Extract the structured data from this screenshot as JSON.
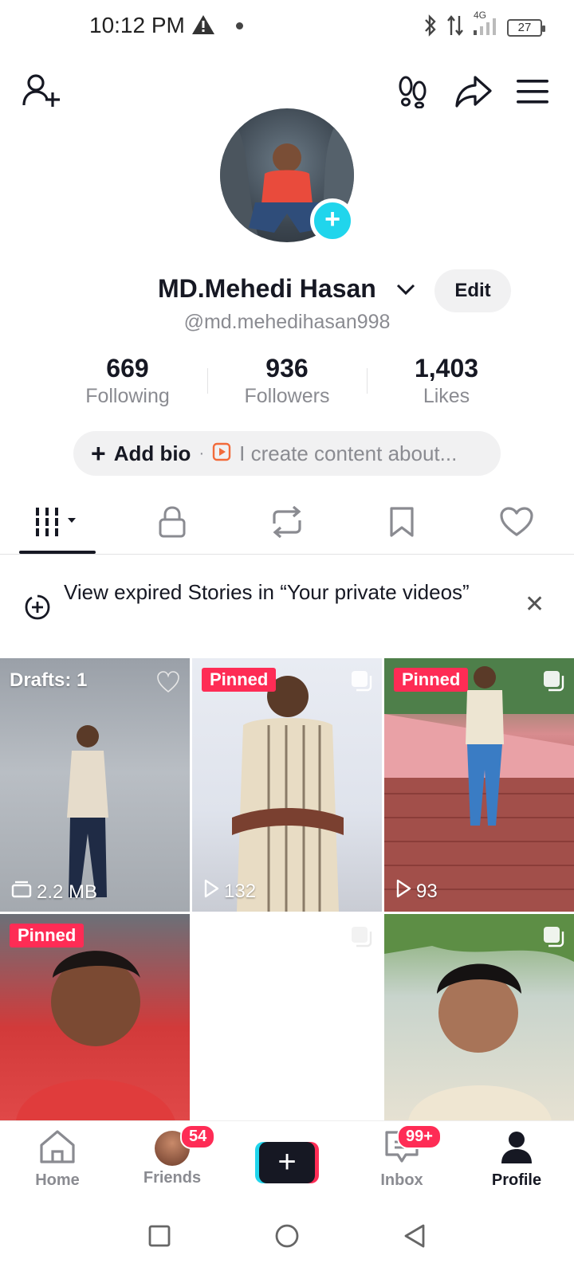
{
  "status_bar": {
    "time": "10:12 PM",
    "network": "4G",
    "battery": "27"
  },
  "header": {
    "icons": [
      "add-friend-icon",
      "footprints-icon",
      "share-icon",
      "menu-icon"
    ]
  },
  "profile": {
    "display_name": "MD.Mehedi Hasan",
    "username": "@md.mehedihasan998",
    "edit_label": "Edit",
    "stats": [
      {
        "value": "669",
        "label": "Following"
      },
      {
        "value": "936",
        "label": "Followers"
      },
      {
        "value": "1,403",
        "label": "Likes"
      }
    ],
    "bio_add": "Add bio",
    "bio_hint": "I create content about..."
  },
  "tabs": [
    "videos-grid-icon",
    "lock-icon",
    "repost-icon",
    "bookmark-icon",
    "heart-icon"
  ],
  "story_banner": {
    "text": "View expired Stories in “Your private videos”"
  },
  "grid": [
    {
      "overlay": "Drafts: 1",
      "bottom": "2.2 MB",
      "type": "drafts"
    },
    {
      "overlay": "Pinned",
      "bottom": "132",
      "type": "pinned"
    },
    {
      "overlay": "Pinned",
      "bottom": "93",
      "type": "pinned"
    },
    {
      "overlay": "Pinned",
      "bottom": "",
      "type": "pinned"
    },
    {
      "overlay": "",
      "bottom": "",
      "type": "blank"
    },
    {
      "overlay": "",
      "bottom": "",
      "type": "video"
    }
  ],
  "bottom_nav": {
    "home": "Home",
    "friends": "Friends",
    "friends_badge": "54",
    "inbox": "Inbox",
    "inbox_badge": "99+",
    "profile": "Profile"
  },
  "colors": {
    "accent": "#fe2c55",
    "cyan": "#20d5ec",
    "text": "#161823",
    "muted": "#8a8b91"
  }
}
